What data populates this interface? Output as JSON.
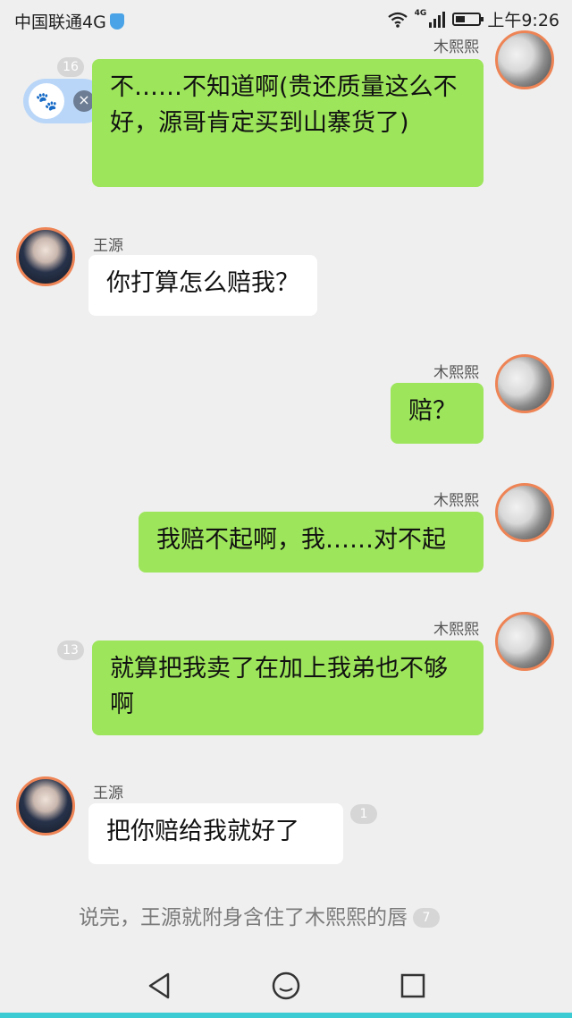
{
  "status_bar": {
    "carrier": "中国联通4G",
    "network": "4G",
    "time": "上午9:26"
  },
  "float_widget": {
    "paw_icon": "paw-icon",
    "close_icon": "close-icon"
  },
  "messages": [
    {
      "sender": "木熙熙",
      "side": "right",
      "text": "不……不知道啊(贵还质量这么不好，源哥肯定买到山寨货了)",
      "count": "16"
    },
    {
      "sender": "王源",
      "side": "left",
      "text": "你打算怎么赔我？"
    },
    {
      "sender": "木熙熙",
      "side": "right",
      "text": "赔？"
    },
    {
      "sender": "木熙熙",
      "side": "right",
      "text": "我赔不起啊，我……对不起"
    },
    {
      "sender": "木熙熙",
      "side": "right",
      "text": "就算把我卖了在加上我弟也不够啊",
      "count": "13"
    },
    {
      "sender": "王源",
      "side": "left",
      "text": "把你赔给我就好了",
      "count": "1"
    }
  ],
  "narration": {
    "text": "说完，王源就附身含住了木熙熙的唇",
    "count": "7"
  },
  "nav": {
    "back": "back-icon",
    "home": "home-icon",
    "recent": "recent-apps-icon"
  },
  "colors": {
    "green_bubble": "#9de55b",
    "white_bubble": "#ffffff",
    "avatar_ring": "#ee8455",
    "accent": "#3ccbd2"
  }
}
